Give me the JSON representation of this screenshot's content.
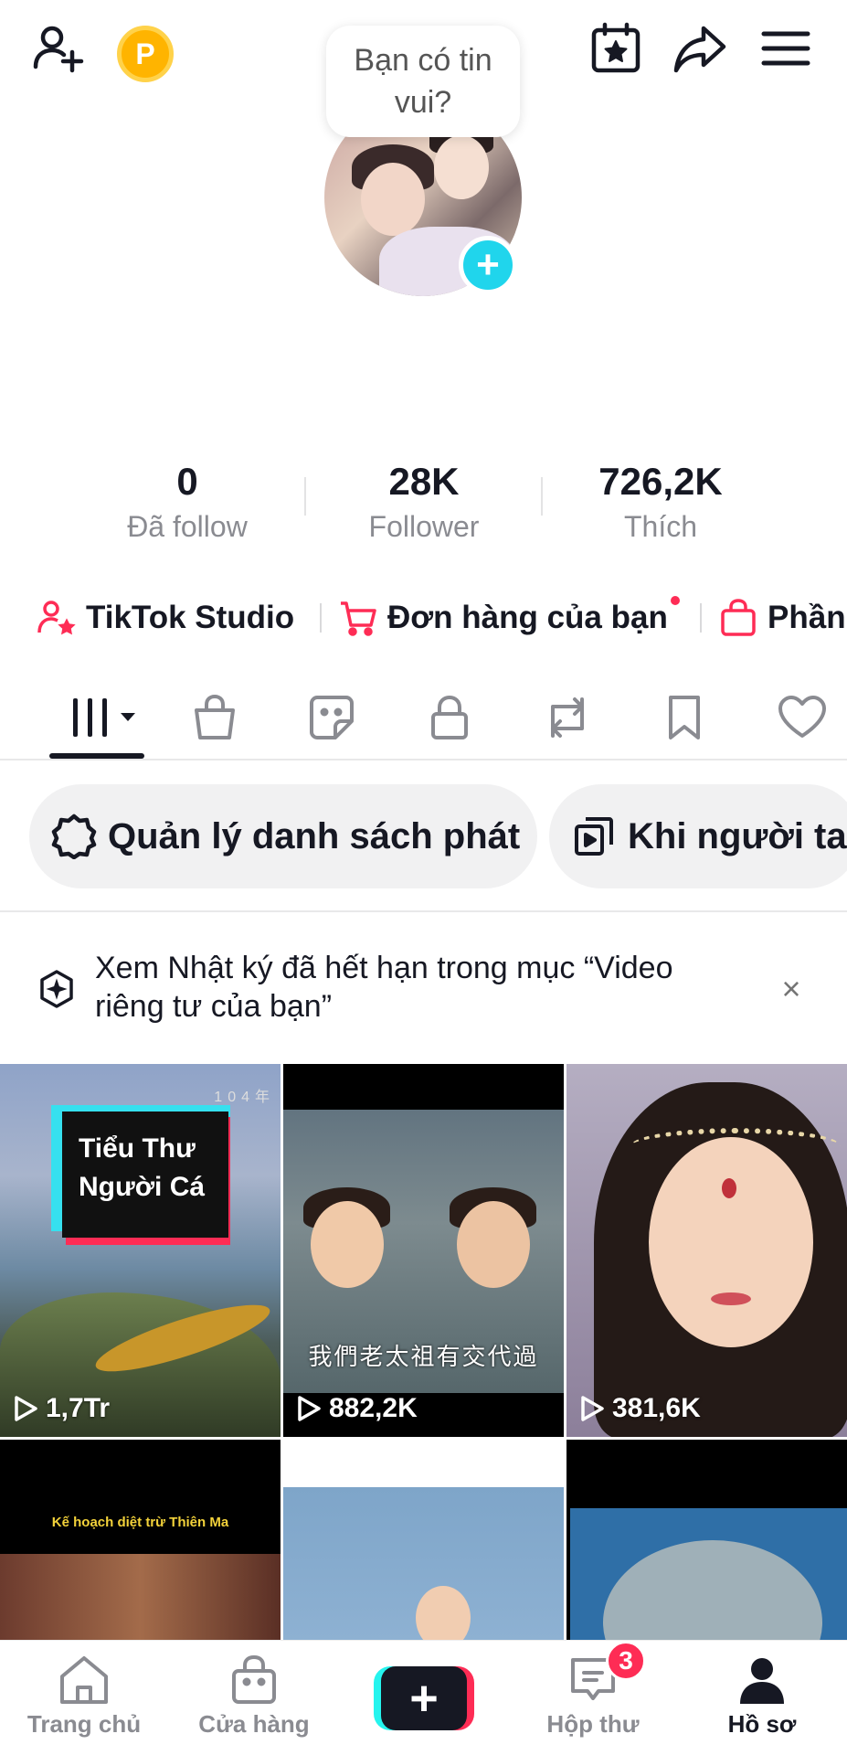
{
  "header": {
    "bubble_text": "Bạn có tin vui?",
    "coin_label": "P"
  },
  "stats": [
    {
      "value": "0",
      "label": "Đã follow"
    },
    {
      "value": "28K",
      "label": "Follower"
    },
    {
      "value": "726,2K",
      "label": "Thích"
    }
  ],
  "links": {
    "studio": "TikTok Studio",
    "orders": "Đơn hàng của bạn",
    "showcase": "Phần"
  },
  "chips": {
    "manage": "Quản lý danh sách phát",
    "when": "Khi người ta"
  },
  "notice": {
    "text": "Xem Nhật ký đã hết hạn trong mục “Video riêng tư của bạn”",
    "close": "×"
  },
  "videos": [
    {
      "views": "1,7Tr",
      "overlay": "Tiểu Thư Người Cá",
      "corner": "104年"
    },
    {
      "views": "882,2K",
      "subtitle": "我們老太祖有交代過"
    },
    {
      "views": "381,6K"
    },
    {
      "overlay": "Kế hoạch diệt trừ Thiên Ma"
    },
    {},
    {}
  ],
  "bottom_nav": {
    "home": "Trang chủ",
    "shop": "Cửa hàng",
    "create": "+",
    "inbox": "Hộp thư",
    "inbox_badge": "3",
    "profile": "Hồ sơ"
  },
  "colors": {
    "accent_red": "#fe2c55",
    "accent_cyan": "#25f4ee",
    "text_primary": "#161823",
    "text_secondary": "#8a8b91",
    "coin": "#ffb400",
    "avatar_add": "#20d5ec"
  }
}
